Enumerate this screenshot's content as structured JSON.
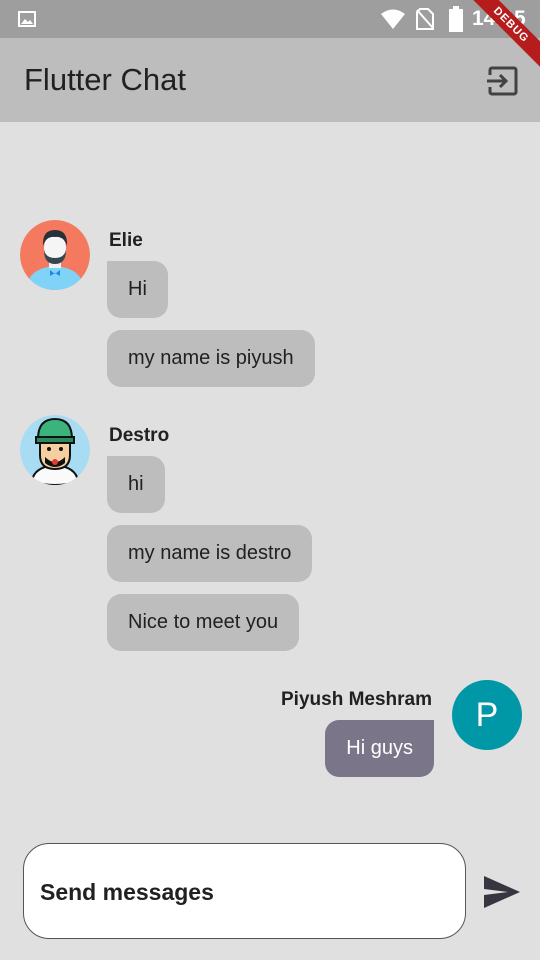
{
  "status_bar": {
    "time": "14:15"
  },
  "debug_banner": "DEBUG",
  "app_bar": {
    "title": "Flutter Chat"
  },
  "messages": [
    {
      "sender": "Elie",
      "texts": [
        "Hi",
        "my name is piyush"
      ]
    },
    {
      "sender": "Destro",
      "texts": [
        "hi",
        "my name is destro",
        "Nice to meet you"
      ]
    },
    {
      "sender": "Piyush Meshram",
      "avatar_letter": "P",
      "texts": [
        "Hi guys"
      ]
    }
  ],
  "input": {
    "placeholder": "Send messages"
  },
  "colors": {
    "my_avatar": "#0097a7",
    "my_bubble": "#7b7589",
    "other_bubble": "#bdbdbd",
    "app_bar": "#bdbdbd"
  }
}
